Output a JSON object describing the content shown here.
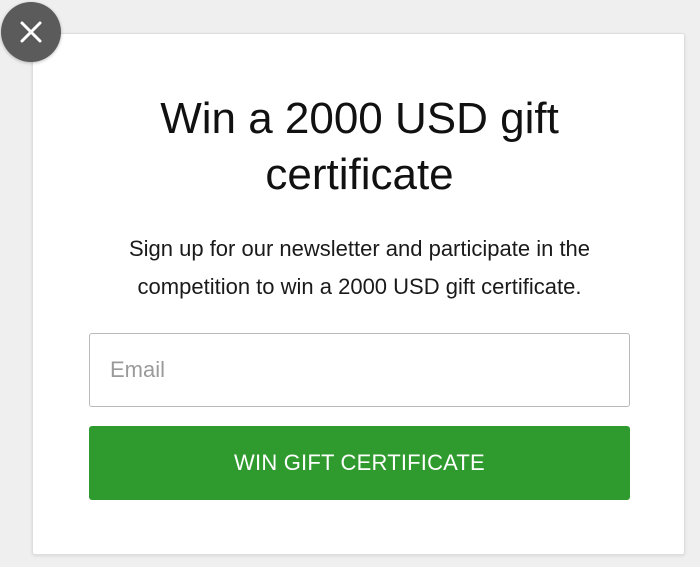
{
  "popup": {
    "title": "Win a 2000 USD gift certificate",
    "description": "Sign up for our newsletter and participate in the competition to win a 2000 USD gift certificate.",
    "email_placeholder": "Email",
    "email_value": "",
    "submit_label": "WIN GIFT CERTIFICATE"
  },
  "close": {
    "icon": "close-icon"
  },
  "colors": {
    "page_background": "#efefef",
    "popup_background": "#ffffff",
    "button_green": "#2f9b2f",
    "close_button_gray": "#5b5b5b",
    "text_dark": "#111111",
    "placeholder_gray": "#9a9a9a"
  }
}
